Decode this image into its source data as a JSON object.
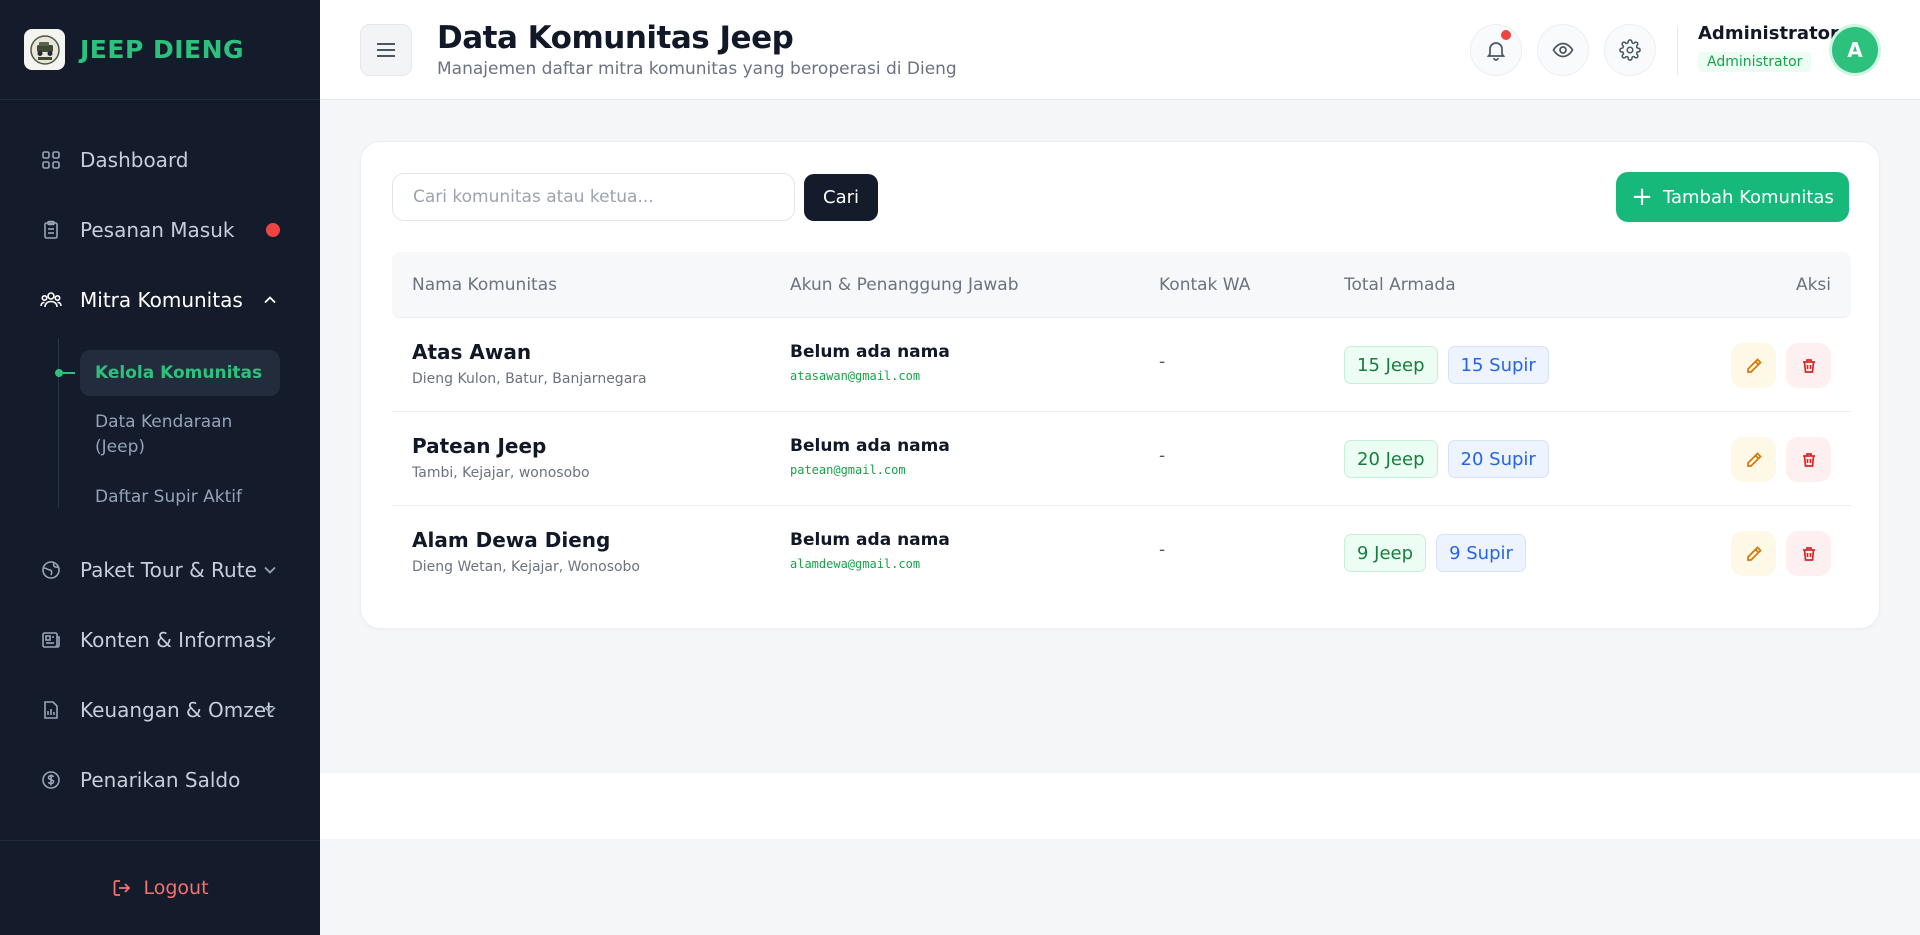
{
  "brand": {
    "name": "JEEP DIENG",
    "logo_text": "JEEP DIENG"
  },
  "sidebar": {
    "items": [
      {
        "label": "Dashboard",
        "icon": "grid-icon"
      },
      {
        "label": "Pesanan Masuk",
        "icon": "clipboard-icon",
        "badge_color": "#ef4444"
      },
      {
        "label": "Mitra Komunitas",
        "icon": "users-icon",
        "expanded": true
      },
      {
        "label": "Paket Tour & Rute",
        "icon": "globe-icon"
      },
      {
        "label": "Konten & Informasi",
        "icon": "newspaper-icon"
      },
      {
        "label": "Keuangan & Omzet",
        "icon": "report-icon"
      },
      {
        "label": "Penarikan Saldo",
        "icon": "dollar-circle-icon"
      }
    ],
    "sub_items": [
      {
        "label": "Kelola Komunitas",
        "active": true
      },
      {
        "label": "Data Kendaraan (Jeep)"
      },
      {
        "label": "Daftar Supir Aktif"
      }
    ],
    "logout_label": "Logout"
  },
  "header": {
    "title": "Data Komunitas Jeep",
    "subtitle": "Manajemen daftar mitra komunitas yang beroperasi di Dieng",
    "user_name": "Administrator",
    "user_role": "Administrator",
    "avatar_initial": "A"
  },
  "toolbar": {
    "search_placeholder": "Cari komunitas atau ketua...",
    "search_button": "Cari",
    "add_button": "Tambah Komunitas"
  },
  "table": {
    "columns": [
      "Nama Komunitas",
      "Akun & Penanggung Jawab",
      "Kontak WA",
      "Total Armada",
      "Aksi"
    ],
    "rows": [
      {
        "name": "Atas Awan",
        "location": "Dieng Kulon, Batur, Banjarnegara",
        "account_name": "Belum ada nama",
        "email": "atasawan@gmail.com",
        "whatsapp": "-",
        "jeep": "15 Jeep",
        "supir": "15 Supir"
      },
      {
        "name": "Patean Jeep",
        "location": "Tambi, Kejajar, wonosobo",
        "account_name": "Belum ada nama",
        "email": "patean@gmail.com",
        "whatsapp": "-",
        "jeep": "20 Jeep",
        "supir": "20 Supir"
      },
      {
        "name": "Alam Dewa Dieng",
        "location": "Dieng Wetan, Kejajar, Wonosobo",
        "account_name": "Belum ada nama",
        "email": "alamdewa@gmail.com",
        "whatsapp": "-",
        "jeep": "9 Jeep",
        "supir": "9 Supir"
      }
    ]
  },
  "colors": {
    "accent": "#2cc27e",
    "sidebar_bg": "#141b2a",
    "danger": "#ef4444"
  }
}
